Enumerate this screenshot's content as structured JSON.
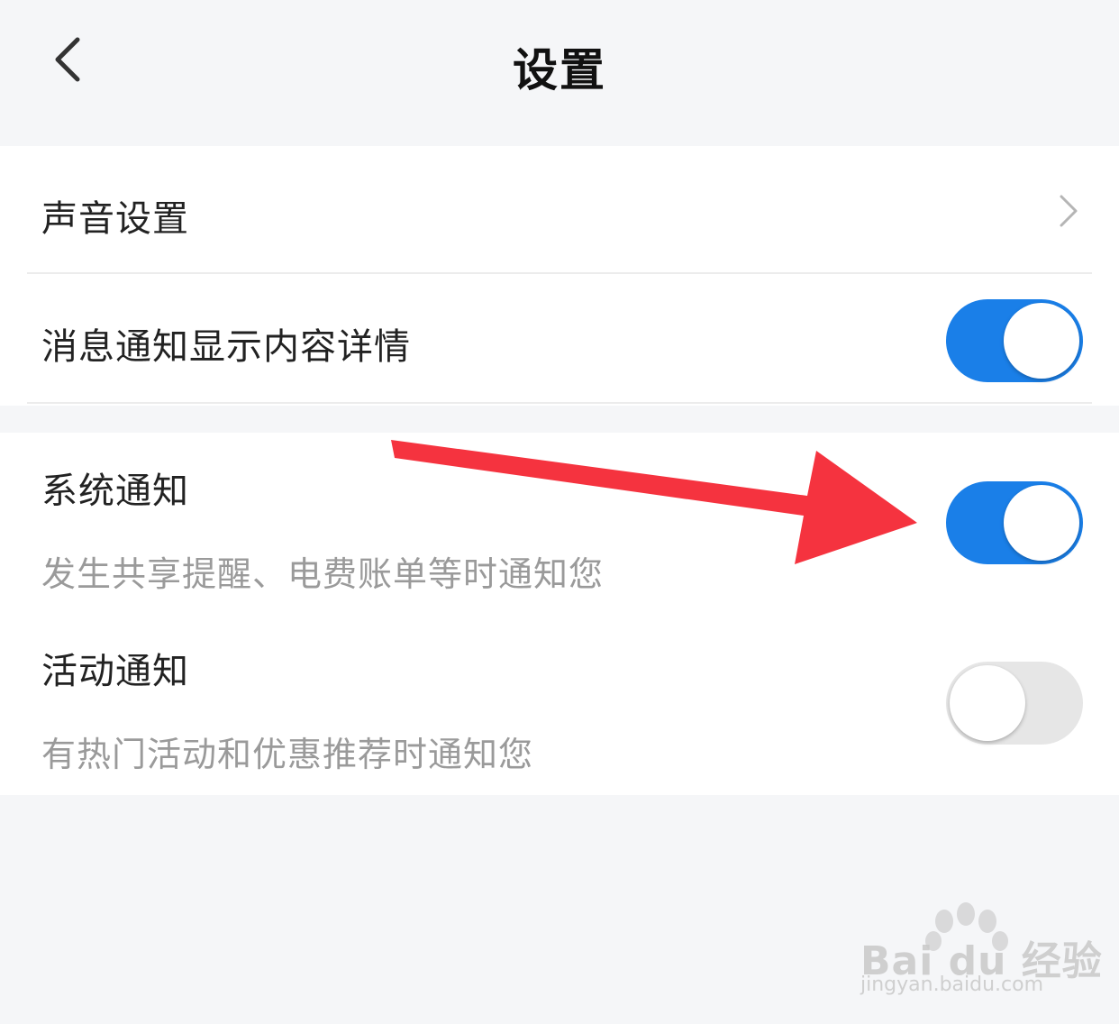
{
  "header": {
    "title": "设置",
    "back_icon": "chevron-left-icon"
  },
  "settings": {
    "sound": {
      "label": "声音设置",
      "icon": "chevron-right-icon"
    },
    "message_detail": {
      "label": "消息通知显示内容详情",
      "enabled": true
    },
    "system_notice": {
      "label": "系统通知",
      "description": "发生共享提醒、电费账单等时通知您",
      "enabled": true
    },
    "activity_notice": {
      "label": "活动通知",
      "description": "有热门活动和优惠推荐时通知您",
      "enabled": false
    }
  },
  "annotation": {
    "icon": "red-arrow-icon",
    "color": "#f5333f"
  },
  "watermark": {
    "brand": "Bai du 经验",
    "url": "jingyan.baidu.com"
  },
  "colors": {
    "toggle_on": "#1a7fe8",
    "toggle_off": "#e6e6e6",
    "background": "#f5f6f8"
  }
}
